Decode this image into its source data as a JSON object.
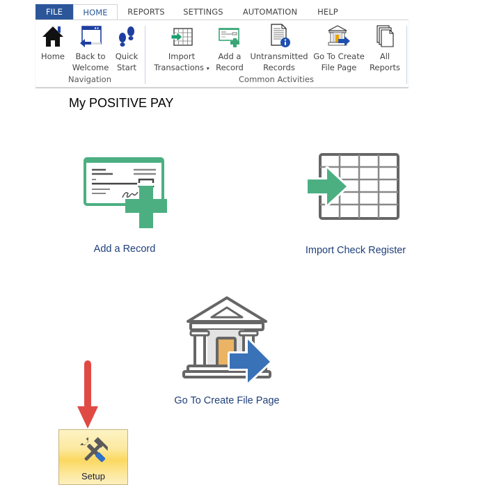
{
  "ribbon": {
    "tabs": [
      {
        "label": "FILE",
        "active": false
      },
      {
        "label": "HOME",
        "active": true
      },
      {
        "label": "REPORTS",
        "active": false
      },
      {
        "label": "SETTINGS",
        "active": false
      },
      {
        "label": "AUTOMATION",
        "active": false
      },
      {
        "label": "HELP",
        "active": false
      }
    ],
    "groups": [
      {
        "label": "Navigation",
        "buttons": [
          {
            "line1": "Home",
            "line2": "",
            "icon": "home-icon"
          },
          {
            "line1": "Back to",
            "line2": "Welcome",
            "icon": "back-window-icon"
          },
          {
            "line1": "Quick",
            "line2": "Start",
            "icon": "footprints-icon"
          }
        ]
      },
      {
        "label": "Common Activities",
        "buttons": [
          {
            "line1": "Import",
            "line2": "Transactions",
            "icon": "import-grid-icon",
            "dropdown": "▾"
          },
          {
            "line1": "Add a",
            "line2": "Record",
            "icon": "check-add-icon"
          },
          {
            "line1": "Untransmitted",
            "line2": "Records",
            "icon": "document-info-icon"
          },
          {
            "line1": "Go To Create",
            "line2": "File Page",
            "icon": "bank-arrow-icon"
          },
          {
            "line1": "All",
            "line2": "Reports",
            "icon": "pages-stack-icon"
          }
        ]
      }
    ]
  },
  "page": {
    "title": "My POSITIVE PAY"
  },
  "tiles": [
    {
      "label": "Add a Record",
      "icon": "check-add-icon"
    },
    {
      "label": "Import Check Register",
      "icon": "import-grid-icon"
    },
    {
      "label": "Go To Create File Page",
      "icon": "bank-arrow-icon"
    }
  ],
  "setup": {
    "label": "Setup",
    "icon": "tools-icon"
  },
  "annotation": {
    "arrow": "down-arrow-pointing-to-setup"
  },
  "colors": {
    "file_tab": "#2b579a",
    "tile_label": "#1f3f7a",
    "green_accent": "#4caf82",
    "blue_accent": "#3a72b8",
    "annotation_red": "#e04a45"
  }
}
